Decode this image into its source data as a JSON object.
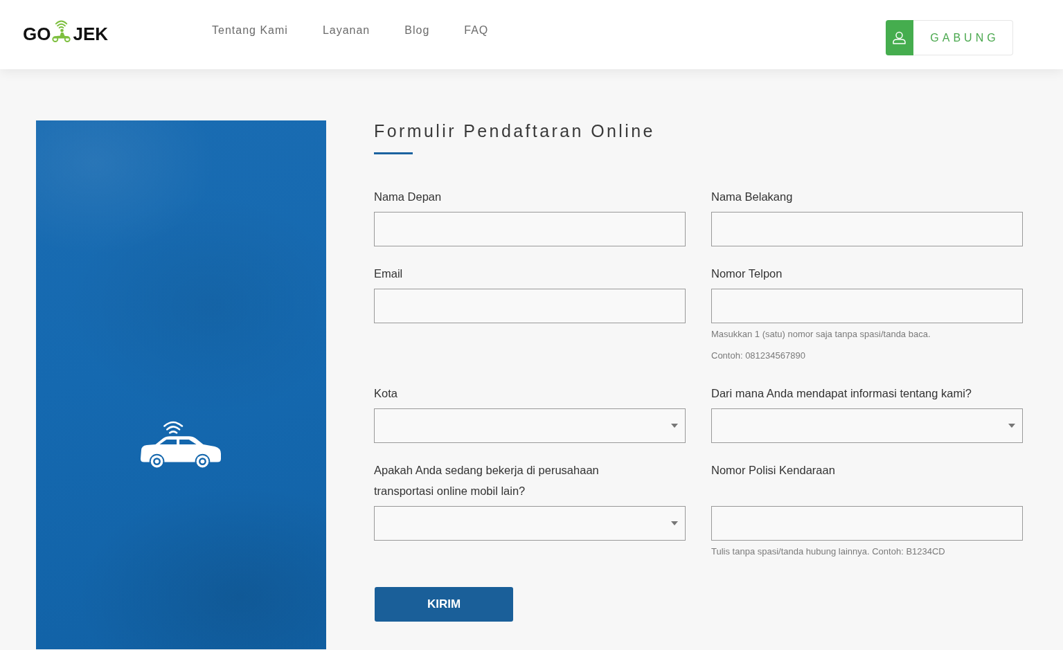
{
  "header": {
    "logo": {
      "left": "GO",
      "right": "JEK"
    },
    "nav": [
      "Tentang Kami",
      "Layanan",
      "Blog",
      "FAQ"
    ],
    "join_button": "GABUNG"
  },
  "form": {
    "title": "Formulir Pendaftaran Online",
    "rows": [
      {
        "fields": [
          {
            "kind": "text",
            "label": "Nama Depan"
          },
          {
            "kind": "text",
            "label": "Nama Belakang"
          }
        ]
      },
      {
        "fields": [
          {
            "kind": "text",
            "label": "Email"
          },
          {
            "kind": "text",
            "label": "Nomor Telpon",
            "helpers": [
              "Masukkan 1 (satu) nomor saja tanpa spasi/tanda baca.",
              "Contoh: 081234567890"
            ]
          }
        ]
      },
      {
        "fields": [
          {
            "kind": "select",
            "label": "Kota"
          },
          {
            "kind": "select",
            "label": "Dari mana Anda mendapat informasi tentang kami?"
          }
        ]
      },
      {
        "fields": [
          {
            "kind": "select",
            "label": "Apakah Anda sedang bekerja di perusahaan transportasi online mobil lain?"
          },
          {
            "kind": "text",
            "label": "Nomor Polisi Kendaraan",
            "helpers": [
              "Tulis tanpa spasi/tanda hubung lainnya. Contoh: B1234CD"
            ]
          }
        ]
      }
    ],
    "submit": "KIRIM"
  }
}
